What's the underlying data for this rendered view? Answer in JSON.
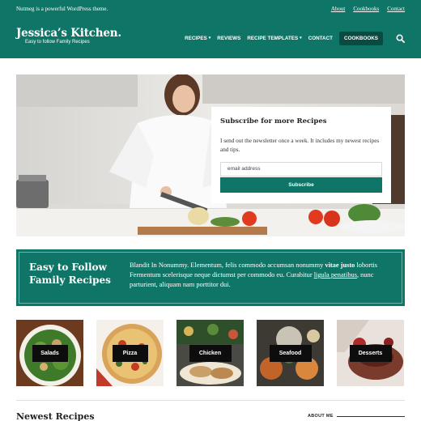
{
  "header": {
    "tagline": "Nutmeg is a powerful WordPress theme.",
    "top_links": [
      "About",
      "Cookbooks",
      "Contact"
    ],
    "site_title": "Jessica’s Kitchen.",
    "site_subtitle": "Easy to follow Family Recipes",
    "nav": [
      {
        "label": "RECIPES",
        "has_dropdown": true
      },
      {
        "label": "REVIEWS",
        "has_dropdown": false
      },
      {
        "label": "RECIPE TEMPLATES",
        "has_dropdown": true
      },
      {
        "label": "CONTACT",
        "has_dropdown": false
      },
      {
        "label": "COOKBOOKS",
        "has_dropdown": false,
        "highlighted": true
      }
    ],
    "search_icon": "search-icon"
  },
  "newsletter": {
    "title": "Subscribe for more Recipes",
    "text": "I send out the newsletter once a week. It includes my newest recipes and tips.",
    "email_placeholder": "email address",
    "button_label": "Subscribe"
  },
  "banner": {
    "title": "Easy to Follow Family Recipes",
    "text_1": "Blandit In Nonummy. Elementum, felis commodo accumsan nonummy ",
    "text_bold": "vitae justo",
    "text_2": " lobortis Fermentum scelerisque neque dictumst per commodo eu. Curabitur ",
    "text_link": "ligula penatibus",
    "text_3": ", nunc parturient, aliquam nam porttitor dui."
  },
  "categories": [
    "Salads",
    "Pizza",
    "Chicken",
    "Seafood",
    "Desserts"
  ],
  "sections": {
    "newest_title": "Newest Recipes",
    "about_label": "ABOUT ME"
  },
  "colors": {
    "primary": "#0f7567",
    "primary_dark": "#0a4a41",
    "label_bg": "#0d0d0d"
  }
}
